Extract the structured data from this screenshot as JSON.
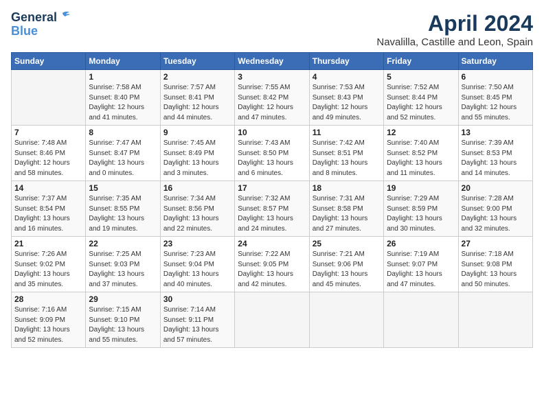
{
  "logo": {
    "line1": "General",
    "line2": "Blue"
  },
  "title": "April 2024",
  "subtitle": "Navalilla, Castille and Leon, Spain",
  "headers": [
    "Sunday",
    "Monday",
    "Tuesday",
    "Wednesday",
    "Thursday",
    "Friday",
    "Saturday"
  ],
  "weeks": [
    [
      {
        "num": "",
        "sunrise": "",
        "sunset": "",
        "daylight": ""
      },
      {
        "num": "1",
        "sunrise": "7:58 AM",
        "sunset": "8:40 PM",
        "daylight": "12 hours and 41 minutes."
      },
      {
        "num": "2",
        "sunrise": "7:57 AM",
        "sunset": "8:41 PM",
        "daylight": "12 hours and 44 minutes."
      },
      {
        "num": "3",
        "sunrise": "7:55 AM",
        "sunset": "8:42 PM",
        "daylight": "12 hours and 47 minutes."
      },
      {
        "num": "4",
        "sunrise": "7:53 AM",
        "sunset": "8:43 PM",
        "daylight": "12 hours and 49 minutes."
      },
      {
        "num": "5",
        "sunrise": "7:52 AM",
        "sunset": "8:44 PM",
        "daylight": "12 hours and 52 minutes."
      },
      {
        "num": "6",
        "sunrise": "7:50 AM",
        "sunset": "8:45 PM",
        "daylight": "12 hours and 55 minutes."
      }
    ],
    [
      {
        "num": "7",
        "sunrise": "7:48 AM",
        "sunset": "8:46 PM",
        "daylight": "12 hours and 58 minutes."
      },
      {
        "num": "8",
        "sunrise": "7:47 AM",
        "sunset": "8:47 PM",
        "daylight": "13 hours and 0 minutes."
      },
      {
        "num": "9",
        "sunrise": "7:45 AM",
        "sunset": "8:49 PM",
        "daylight": "13 hours and 3 minutes."
      },
      {
        "num": "10",
        "sunrise": "7:43 AM",
        "sunset": "8:50 PM",
        "daylight": "13 hours and 6 minutes."
      },
      {
        "num": "11",
        "sunrise": "7:42 AM",
        "sunset": "8:51 PM",
        "daylight": "13 hours and 8 minutes."
      },
      {
        "num": "12",
        "sunrise": "7:40 AM",
        "sunset": "8:52 PM",
        "daylight": "13 hours and 11 minutes."
      },
      {
        "num": "13",
        "sunrise": "7:39 AM",
        "sunset": "8:53 PM",
        "daylight": "13 hours and 14 minutes."
      }
    ],
    [
      {
        "num": "14",
        "sunrise": "7:37 AM",
        "sunset": "8:54 PM",
        "daylight": "13 hours and 16 minutes."
      },
      {
        "num": "15",
        "sunrise": "7:35 AM",
        "sunset": "8:55 PM",
        "daylight": "13 hours and 19 minutes."
      },
      {
        "num": "16",
        "sunrise": "7:34 AM",
        "sunset": "8:56 PM",
        "daylight": "13 hours and 22 minutes."
      },
      {
        "num": "17",
        "sunrise": "7:32 AM",
        "sunset": "8:57 PM",
        "daylight": "13 hours and 24 minutes."
      },
      {
        "num": "18",
        "sunrise": "7:31 AM",
        "sunset": "8:58 PM",
        "daylight": "13 hours and 27 minutes."
      },
      {
        "num": "19",
        "sunrise": "7:29 AM",
        "sunset": "8:59 PM",
        "daylight": "13 hours and 30 minutes."
      },
      {
        "num": "20",
        "sunrise": "7:28 AM",
        "sunset": "9:00 PM",
        "daylight": "13 hours and 32 minutes."
      }
    ],
    [
      {
        "num": "21",
        "sunrise": "7:26 AM",
        "sunset": "9:02 PM",
        "daylight": "13 hours and 35 minutes."
      },
      {
        "num": "22",
        "sunrise": "7:25 AM",
        "sunset": "9:03 PM",
        "daylight": "13 hours and 37 minutes."
      },
      {
        "num": "23",
        "sunrise": "7:23 AM",
        "sunset": "9:04 PM",
        "daylight": "13 hours and 40 minutes."
      },
      {
        "num": "24",
        "sunrise": "7:22 AM",
        "sunset": "9:05 PM",
        "daylight": "13 hours and 42 minutes."
      },
      {
        "num": "25",
        "sunrise": "7:21 AM",
        "sunset": "9:06 PM",
        "daylight": "13 hours and 45 minutes."
      },
      {
        "num": "26",
        "sunrise": "7:19 AM",
        "sunset": "9:07 PM",
        "daylight": "13 hours and 47 minutes."
      },
      {
        "num": "27",
        "sunrise": "7:18 AM",
        "sunset": "9:08 PM",
        "daylight": "13 hours and 50 minutes."
      }
    ],
    [
      {
        "num": "28",
        "sunrise": "7:16 AM",
        "sunset": "9:09 PM",
        "daylight": "13 hours and 52 minutes."
      },
      {
        "num": "29",
        "sunrise": "7:15 AM",
        "sunset": "9:10 PM",
        "daylight": "13 hours and 55 minutes."
      },
      {
        "num": "30",
        "sunrise": "7:14 AM",
        "sunset": "9:11 PM",
        "daylight": "13 hours and 57 minutes."
      },
      {
        "num": "",
        "sunrise": "",
        "sunset": "",
        "daylight": ""
      },
      {
        "num": "",
        "sunrise": "",
        "sunset": "",
        "daylight": ""
      },
      {
        "num": "",
        "sunrise": "",
        "sunset": "",
        "daylight": ""
      },
      {
        "num": "",
        "sunrise": "",
        "sunset": "",
        "daylight": ""
      }
    ]
  ]
}
